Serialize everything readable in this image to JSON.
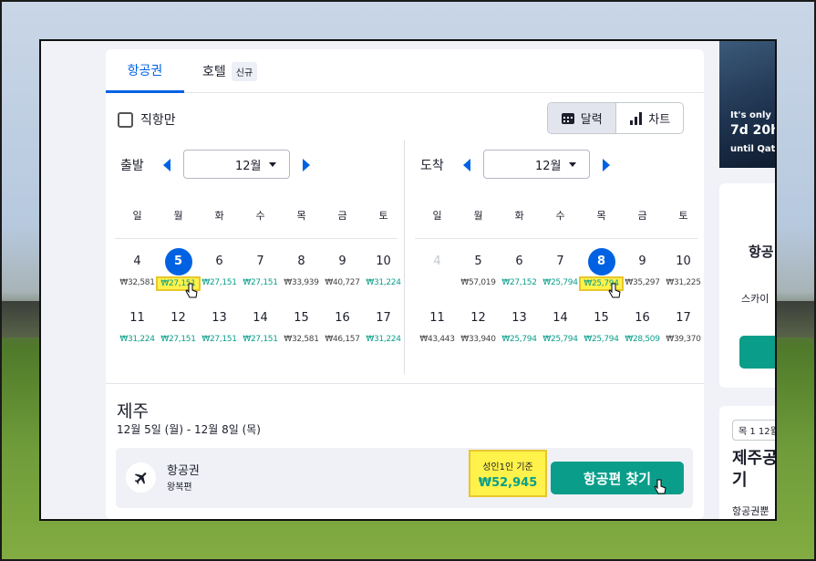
{
  "tabs": {
    "flights": "항공권",
    "hotels": "호텔",
    "new_badge": "신규"
  },
  "filter": {
    "direct_only": "직항만"
  },
  "view_toggle": {
    "calendar": "달력",
    "chart": "차트"
  },
  "departure": {
    "label": "출발",
    "month": "12월",
    "weekdays": [
      "일",
      "월",
      "화",
      "수",
      "목",
      "금",
      "토"
    ],
    "weeks": [
      [
        {
          "day": "4",
          "price": "₩32,581",
          "color": "gray"
        },
        {
          "day": "5",
          "price": "₩27,151",
          "color": "green",
          "selected": true,
          "highlight": true
        },
        {
          "day": "6",
          "price": "₩27,151",
          "color": "green"
        },
        {
          "day": "7",
          "price": "₩27,151",
          "color": "green"
        },
        {
          "day": "8",
          "price": "₩33,939",
          "color": "gray"
        },
        {
          "day": "9",
          "price": "₩40,727",
          "color": "gray"
        },
        {
          "day": "10",
          "price": "₩31,224",
          "color": "green"
        }
      ],
      [
        {
          "day": "11",
          "price": "₩31,224",
          "color": "green"
        },
        {
          "day": "12",
          "price": "₩27,151",
          "color": "green"
        },
        {
          "day": "13",
          "price": "₩27,151",
          "color": "green"
        },
        {
          "day": "14",
          "price": "₩27,151",
          "color": "green"
        },
        {
          "day": "15",
          "price": "₩32,581",
          "color": "gray"
        },
        {
          "day": "16",
          "price": "₩46,157",
          "color": "gray"
        },
        {
          "day": "17",
          "price": "₩31,224",
          "color": "green"
        }
      ]
    ]
  },
  "arrival": {
    "label": "도착",
    "month": "12월",
    "weekdays": [
      "일",
      "월",
      "화",
      "수",
      "목",
      "금",
      "토"
    ],
    "weeks": [
      [
        {
          "day": "4",
          "price": "",
          "color": "gray",
          "muted": true
        },
        {
          "day": "5",
          "price": "₩57,019",
          "color": "gray"
        },
        {
          "day": "6",
          "price": "₩27,152",
          "color": "green"
        },
        {
          "day": "7",
          "price": "₩25,794",
          "color": "green"
        },
        {
          "day": "8",
          "price": "₩25,794",
          "color": "green",
          "selected": true,
          "highlight": true
        },
        {
          "day": "9",
          "price": "₩35,297",
          "color": "gray"
        },
        {
          "day": "10",
          "price": "₩31,225",
          "color": "gray"
        }
      ],
      [
        {
          "day": "11",
          "price": "₩43,443",
          "color": "gray"
        },
        {
          "day": "12",
          "price": "₩33,940",
          "color": "gray"
        },
        {
          "day": "13",
          "price": "₩25,794",
          "color": "green"
        },
        {
          "day": "14",
          "price": "₩25,794",
          "color": "green"
        },
        {
          "day": "15",
          "price": "₩25,794",
          "color": "green"
        },
        {
          "day": "16",
          "price": "₩28,509",
          "color": "green"
        },
        {
          "day": "17",
          "price": "₩39,370",
          "color": "gray"
        }
      ]
    ]
  },
  "summary": {
    "destination": "제주",
    "dates": "12월 5일 (월) - 12월 8일 (목)"
  },
  "result": {
    "title": "항공권",
    "subtitle": "왕복편",
    "price_label": "성인1인 기준",
    "price": "₩52,945",
    "cta": "항공편 찾기"
  },
  "side": {
    "promo_line1": "It's only",
    "promo_line2": "7d 20h",
    "promo_line3": "until Qat",
    "card_title": "항공",
    "card_sub": "스카이",
    "chip": "목 1 12월",
    "card2_title": "제주공 기",
    "card2_sub": "항공권뿐"
  },
  "colors": {
    "accent_blue": "#0062e3",
    "teal": "#0a9e8a",
    "highlight": "#fff24a"
  }
}
